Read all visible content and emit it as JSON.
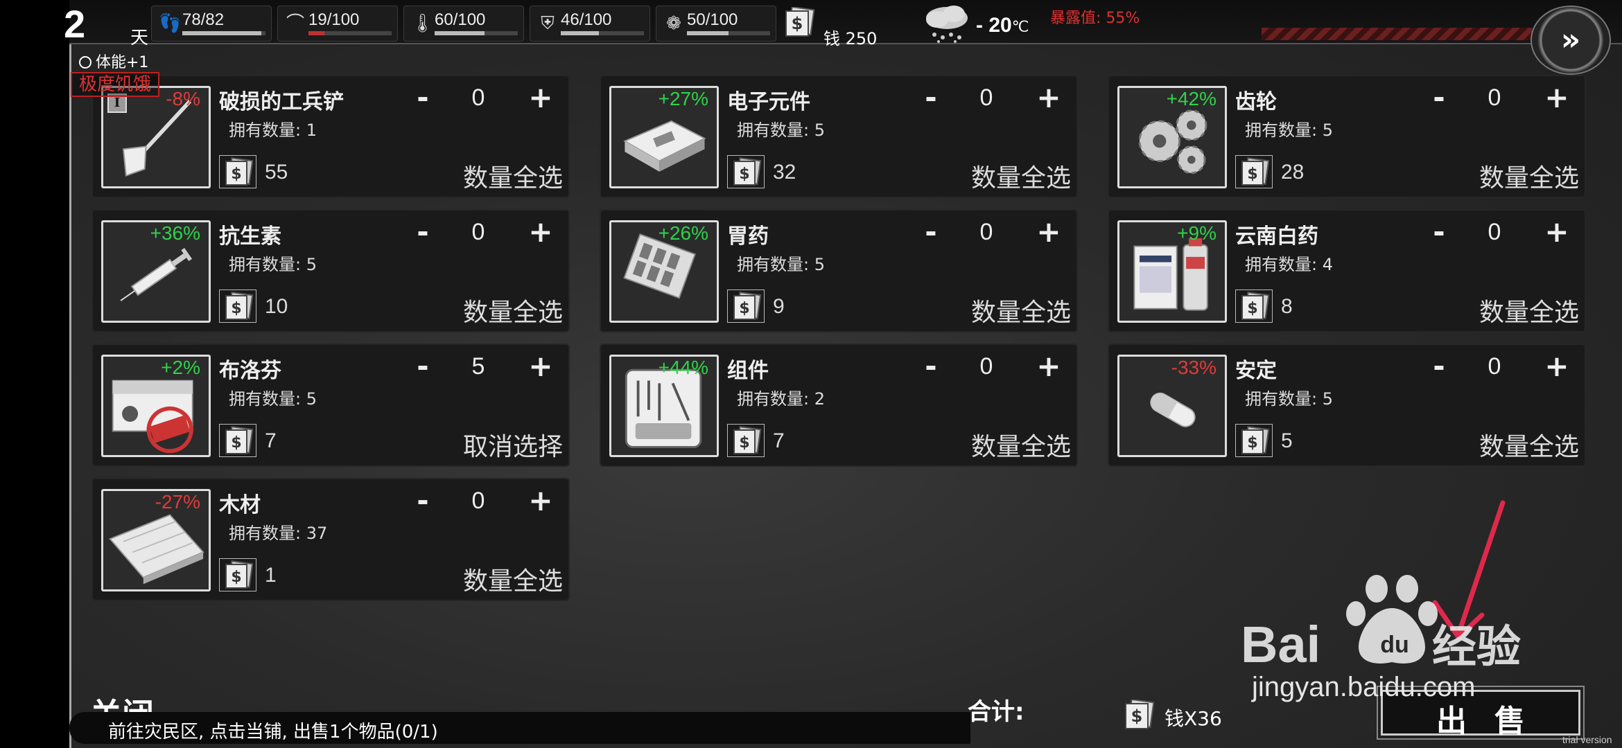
{
  "hud": {
    "day_number": "2",
    "day_label": "天",
    "stats": [
      {
        "icon": "footprints-icon",
        "glyph": "👣",
        "value": "78/82",
        "level": 0.95,
        "color": "#bbbbbb"
      },
      {
        "icon": "stomach-icon",
        "glyph": "⌒",
        "value": "19/100",
        "level": 0.19,
        "color": "#c03030"
      },
      {
        "icon": "thermometer-icon",
        "glyph": "🌡",
        "value": "60/100",
        "level": 0.6,
        "color": "#bbbbbb"
      },
      {
        "icon": "health-shield-icon",
        "glyph": "⛨",
        "value": "46/100",
        "level": 0.46,
        "color": "#bbbbbb"
      },
      {
        "icon": "brain-icon",
        "glyph": "❁",
        "value": "50/100",
        "level": 0.5,
        "color": "#bbbbbb"
      }
    ],
    "money_label": "钱 250",
    "temperature": "- 20",
    "temperature_unit": "℃",
    "exposure": "暴露值: 55%",
    "buff": "体能+1",
    "status_warning": "极度饥饿"
  },
  "select_all_label": "数量全选",
  "owned_prefix": "拥有数量: ",
  "items": [
    {
      "name": "破损的工兵铲",
      "icon": "shovel-icon",
      "pct": "-8%",
      "pct_sign": "neg",
      "owned": "1",
      "price": "55",
      "qty": "0",
      "action": "数量全选",
      "level_badge": "I"
    },
    {
      "name": "电子元件",
      "icon": "electronic-component-icon",
      "pct": "+27%",
      "pct_sign": "pos",
      "owned": "5",
      "price": "32",
      "qty": "0",
      "action": "数量全选"
    },
    {
      "name": "齿轮",
      "icon": "gears-icon",
      "pct": "+42%",
      "pct_sign": "pos",
      "owned": "5",
      "price": "28",
      "qty": "0",
      "action": "数量全选"
    },
    {
      "name": "抗生素",
      "icon": "syringe-icon",
      "pct": "+36%",
      "pct_sign": "pos",
      "owned": "5",
      "price": "10",
      "qty": "0",
      "action": "数量全选"
    },
    {
      "name": "胃药",
      "icon": "pill-blister-icon",
      "pct": "+26%",
      "pct_sign": "pos",
      "owned": "5",
      "price": "9",
      "qty": "0",
      "action": "数量全选"
    },
    {
      "name": "云南白药",
      "icon": "medicine-box-icon",
      "pct": "+9%",
      "pct_sign": "pos",
      "owned": "4",
      "price": "8",
      "qty": "0",
      "action": "数量全选"
    },
    {
      "name": "布洛芬",
      "icon": "ibuprofen-box-icon",
      "pct": "+2%",
      "pct_sign": "pos",
      "owned": "5",
      "price": "7",
      "qty": "5",
      "action": "取消选择"
    },
    {
      "name": "组件",
      "icon": "toolkit-icon",
      "pct": "+44%",
      "pct_sign": "pos",
      "owned": "2",
      "price": "7",
      "qty": "0",
      "action": "数量全选"
    },
    {
      "name": "安定",
      "icon": "capsule-icon",
      "pct": "-33%",
      "pct_sign": "neg",
      "owned": "5",
      "price": "5",
      "qty": "0",
      "action": "数量全选"
    },
    {
      "name": "木材",
      "icon": "wood-planks-icon",
      "pct": "-27%",
      "pct_sign": "neg",
      "owned": "37",
      "price": "1",
      "qty": "0",
      "action": "数量全选"
    }
  ],
  "footer": {
    "close": "关闭",
    "hint": "前往灾民区, 点击当铺, 出售1个物品(0/1)",
    "total_label": "合计:",
    "total_value": "钱X36",
    "sell": "出售"
  },
  "watermark": {
    "brand": "Baidu经验",
    "url": "jingyan.baidu.com"
  },
  "trial": "trial version"
}
